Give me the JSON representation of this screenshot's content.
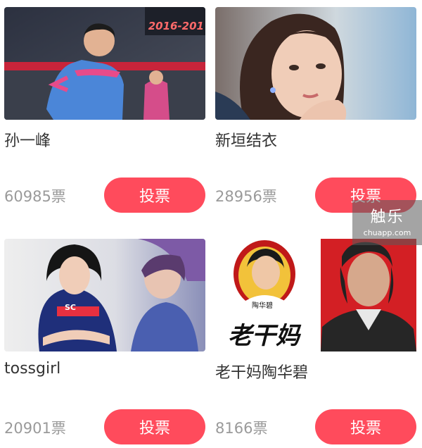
{
  "candidates": [
    {
      "name": "孙一峰",
      "votes": "60985票",
      "button": "投票",
      "photo_text": "2016-201"
    },
    {
      "name": "新垣结衣",
      "votes": "28956票",
      "button": "投票"
    },
    {
      "name": "tossgirl",
      "votes": "20901票",
      "button": "投票",
      "photo_text": "SC"
    },
    {
      "name": "老干妈陶华碧",
      "votes": "8166票",
      "button": "投票",
      "photo_text": "陶华碧",
      "logo_text": "老干妈"
    }
  ],
  "watermark": {
    "title": "触乐",
    "url": "chuapp.com"
  },
  "colors": {
    "accent": "#ff4b5c",
    "name_text": "#333333",
    "vote_text": "#9a9a9a"
  }
}
